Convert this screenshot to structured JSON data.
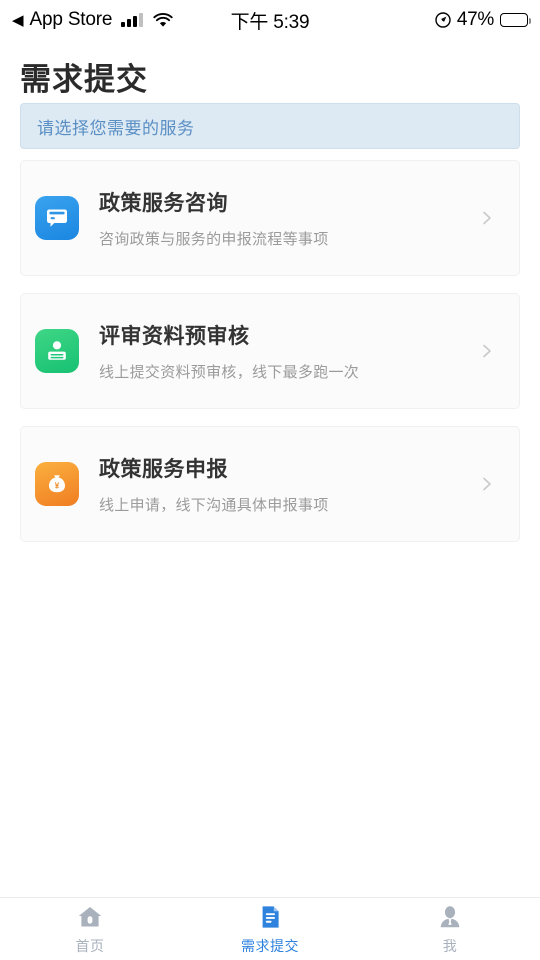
{
  "status_bar": {
    "back_arrow": "◀",
    "back_app": "App Store",
    "signal_icon": "cellular-signal-icon",
    "wifi_icon": "wifi-icon",
    "time": "下午 5:39",
    "location_icon": "location-arrow-icon",
    "battery_percent": "47%",
    "battery_icon": "battery-icon",
    "battery_level": 47
  },
  "header": {
    "title": "需求提交",
    "hint": "请选择您需要的服务"
  },
  "services": [
    {
      "icon": "chat-bubble-icon",
      "icon_color": "#1a86e0",
      "title": "政策服务咨询",
      "subtitle": "咨询政策与服务的申报流程等事项",
      "chevron": "chevron-right-icon"
    },
    {
      "icon": "id-card-person-icon",
      "icon_color": "#17c172",
      "title": "评审资料预审核",
      "subtitle": "线上提交资料预审核，线下最多跑一次",
      "chevron": "chevron-right-icon"
    },
    {
      "icon": "money-bag-icon",
      "icon_color": "#f07d22",
      "title": "政策服务申报",
      "subtitle": "线上申请，线下沟通具体申报事项",
      "chevron": "chevron-right-icon"
    }
  ],
  "tabbar": {
    "active_color": "#2f82dd",
    "inactive_color": "#a9b1bd",
    "items": [
      {
        "icon": "home-icon",
        "label": "首页",
        "active": false
      },
      {
        "icon": "document-icon",
        "label": "需求提交",
        "active": true
      },
      {
        "icon": "person-icon",
        "label": "我",
        "active": false
      }
    ]
  }
}
